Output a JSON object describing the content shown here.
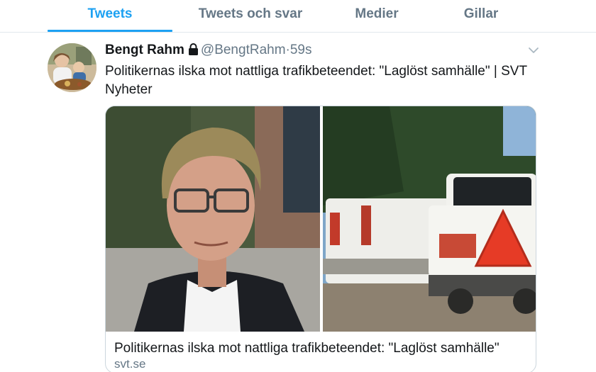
{
  "tabs": [
    {
      "label": "Tweets",
      "active": true
    },
    {
      "label": "Tweets och svar",
      "active": false
    },
    {
      "label": "Medier",
      "active": false
    },
    {
      "label": "Gillar",
      "active": false
    }
  ],
  "tweet": {
    "name": "Bengt Rahm",
    "protected_icon": "lock-icon",
    "handle": "@BengtRahm",
    "separator": "·",
    "time": "59s",
    "text": "Politikernas ilska mot nattliga trafikbeteendet: \"Laglöst samhälle\" | SVT Nyheter",
    "card": {
      "title": "Politikernas ilska mot nattliga trafikbeteendet: \"Laglöst samhälle\"",
      "domain": "svt.se"
    }
  },
  "colors": {
    "accent": "#1da1f2",
    "secondary_text": "#657786",
    "border": "#e1e8ed"
  }
}
